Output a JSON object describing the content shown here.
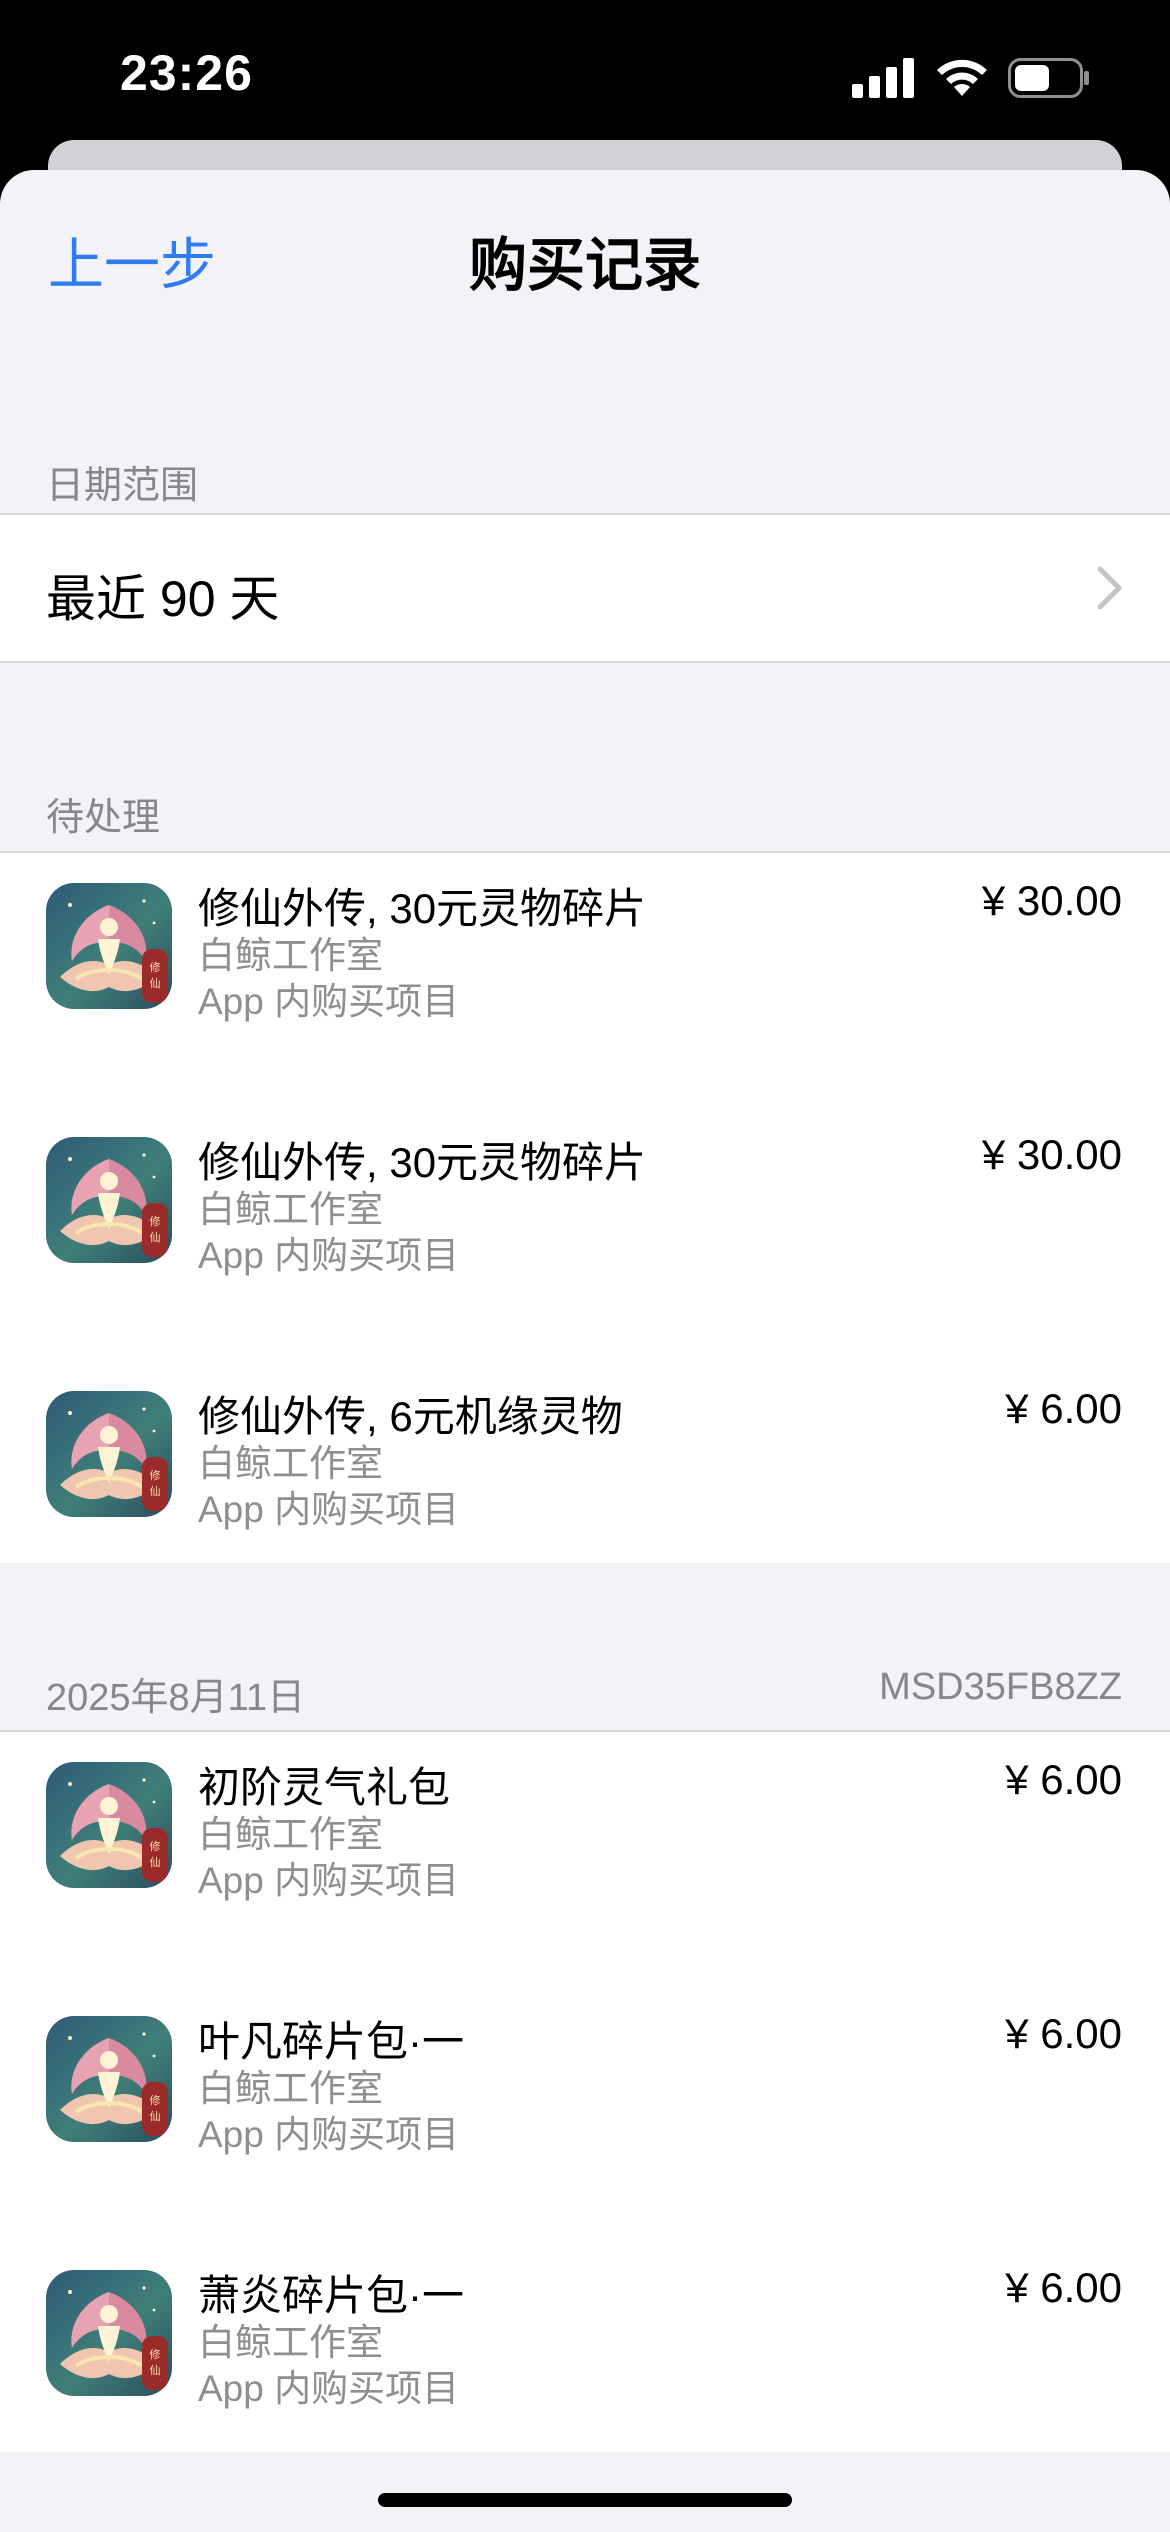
{
  "status_bar": {
    "time": "23:26"
  },
  "nav": {
    "back_label": "上一步",
    "title": "购买记录"
  },
  "date_range": {
    "header": "日期范围",
    "value": "最近 90 天"
  },
  "pending": {
    "header": "待处理",
    "items": [
      {
        "title": "修仙外传, 30元灵物碎片",
        "developer": "白鲸工作室",
        "type": "App 内购买项目",
        "price": "¥ 30.00"
      },
      {
        "title": "修仙外传, 30元灵物碎片",
        "developer": "白鲸工作室",
        "type": "App 内购买项目",
        "price": "¥ 30.00"
      },
      {
        "title": "修仙外传, 6元机缘灵物",
        "developer": "白鲸工作室",
        "type": "App 内购买项目",
        "price": "¥ 6.00"
      }
    ]
  },
  "order": {
    "date": "2025年8月11日",
    "order_id": "MSD35FB8ZZ",
    "items": [
      {
        "title": "初阶灵气礼包",
        "developer": "白鲸工作室",
        "type": "App 内购买项目",
        "price": "¥ 6.00"
      },
      {
        "title": "叶凡碎片包·一",
        "developer": "白鲸工作室",
        "type": "App 内购买项目",
        "price": "¥ 6.00"
      },
      {
        "title": "萧炎碎片包·一",
        "developer": "白鲸工作室",
        "type": "App 内购买项目",
        "price": "¥ 6.00"
      }
    ]
  },
  "app_icon": {
    "name": "game-app-icon",
    "badge_text": "修仙"
  },
  "colors": {
    "accent": "#2f7cf6",
    "background": "#f2f2f7",
    "secondary_text": "#8e8e93"
  }
}
